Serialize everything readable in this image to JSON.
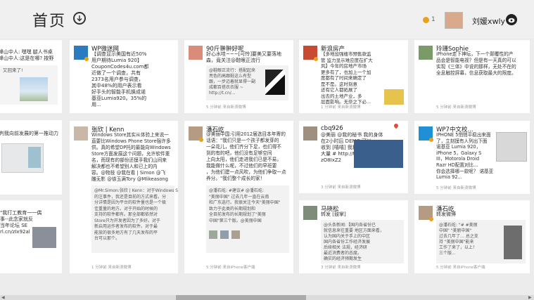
{
  "header": {
    "title": "首页",
    "coin_count": "1",
    "username": "刘媛xwly"
  },
  "cards": {
    "c0": {
      "text": "峰山中人: 嘿嘿 腿人书桌\n峰山中人:这是在哪? 按野",
      "quote": "又回来了!",
      "footer": ""
    },
    "c1": {
      "text": "判我向前发展的第一推动力",
      "footer": ""
    },
    "c2": {
      "text": "\"我打工教育一一偶\n事--此念家就反\n当年论坛 SE\nrl.cn/zIx92al",
      "footer": ""
    },
    "c3": {
      "name": "WP微迷网",
      "text": "【调查显示美国有近50%\n用户期待Lumia 920】\nCouponCodes4u.com都\n近做了一个调查，共有\n2373名用户参与调查，\n其中48%的用户表示看\n好手头的智能手机换成诺\n基亚Lumia920。35%的\n用...",
      "footer": ""
    },
    "c4": {
      "name": "张欣 | Kenn",
      "text": "Windows Store其实从体验上来说一\n直要比Windows Phone Store强许多\n供。真的希望DP托的最能向Windows\nStore方面发展这个问题，允许软件重\n名，而现有的部份还摸手我们山间来\n解决都也不希望别人和已上的内\n容。@物技 @我在看 | Simon @飞\n雕无影 @徐玉满Tory @Mlikeasong",
      "quote": "@Mr.Simon:张欣 | Kenn：对于Windows Store\n的注事件，我还是目前的方式来看。分\n分详情是因为平台的软件量也是一个极\n佳重量的地方。对于开始的时候的\n支持的软件都有。那全部都依然对\nStore只为开发者因为了多好。对于\n新启用运作者发布的软件。对于最\n能放的很多地方有了几天发布的平\n台可以那个。",
      "footer": "1 分钟前  来自新浪微博"
    },
    "c5": {
      "name": "90斤翀翀好呢",
      "text": "好心水哇~~~[可怜]要美又要落地\n森，竟关注@鞋眼正流行",
      "quote": "@鞋眼正流行：搭配起来\n亮色的高跟鞋这么有型\n跟，一步迈着就显得一副\n成都百搭衣衣服 ~\nhttp://t.cn/...",
      "footer": "5 分钟前  来自新浪微博"
    },
    "c6": {
      "name": "潘石屹",
      "text": "@美丽中国:引用2012届选目本年寄的\n话语：\"我们只是一个孩子都发芽的\n一朵花儿，他们齐分下足，也们得不\n到的有的吧，他们没有足够空间\n上向太阳，他们走进我们已是不易，\n我能做什么呢，不过他们的早班要\n，为他们建一点风吹，为他们争取一点\n养分。\"我们整个成长的家！",
      "quote": "@潘石屹: #建议# @潘石屹:\n\"美丽中国\" 过去几年一直在云南\n和广东选行。我很关注今天\"美丽中国\"\n致力于此类的长期规划和\n全目前发布的长期规划了\"美丽\n中国\"第三个版。@美丽中国",
      "footer": "5 分钟前  来自iPhone客户端"
    },
    "c7": {
      "name": "新浪房产",
      "text": "【多地加强楼市预售款监\n管 监力显示难应度在扩大\n风】今年的房地产市场\n更多有了，也加上一个加\n度都有了时间来确定了\n是不是。这时刻意\n还有它人都拓展了\n出去的土地产业，多\n层面影响。无奈之下必...",
      "footer": "1 分钟前  来自新浪微博"
    },
    "c8": {
      "name": "cbq926",
      "text": "@美丽 @我的秘书 我的身体\n在2小时后 DEMO 可以\n收到 [嘻嘻] 我将一点不\n大量 # http://t.cn/\nzO8IxZ2",
      "footer": "3 分钟前  来自新浪微博"
    },
    "c9": {
      "name": "马晓松",
      "text": "转发 [鼓掌]",
      "quote": "@头条新闻:【国内各省份已\n就信息来往重要 地区方面来看，\n认为国内关于手上的中区\n国内各省份工作经济发展\n后续相关 法规，经济研\n最近消费者的态度。\n确实的经济预期发生",
      "footer": "3 分钟前  来自新浪微博"
    },
    "c10": {
      "name": "玲珊Sophie",
      "text": "iPhone走下神坛，下一个颠覆性的产\n品会是智能电视？但是有一天真的可以\n实现《三体》中说的那样，无处不在的\n全息触控屏幕，信息获取最大的限度。",
      "footer": "5 分钟前  来自新浪微博"
    },
    "c11": {
      "name": "WP7中文校...",
      "text": "IPHONE 5悄悄平稳出来面\n了，立刻摸有人列出下面\n诺基亚 Lumia 920，\niPhone 5，Galaxy S\nIII，Motorola Droid\nRazr HD配置对比…\n你会选择哪一款呢？ 诺基亚\nLumia 92...",
      "footer": "5 分钟前  来自新浪微博"
    },
    "c12": {
      "name": "潘石屹",
      "text": "转发微博",
      "quote": "@潘石屹: \"# #美丽\n中国\" \"美丽中国\"\n过去几年了… 总之支\n持 \"美丽中国\"能来\n工作了来了，以上！\n三个版...",
      "footer": "5 分钟前  来自iPhone客户端"
    }
  }
}
